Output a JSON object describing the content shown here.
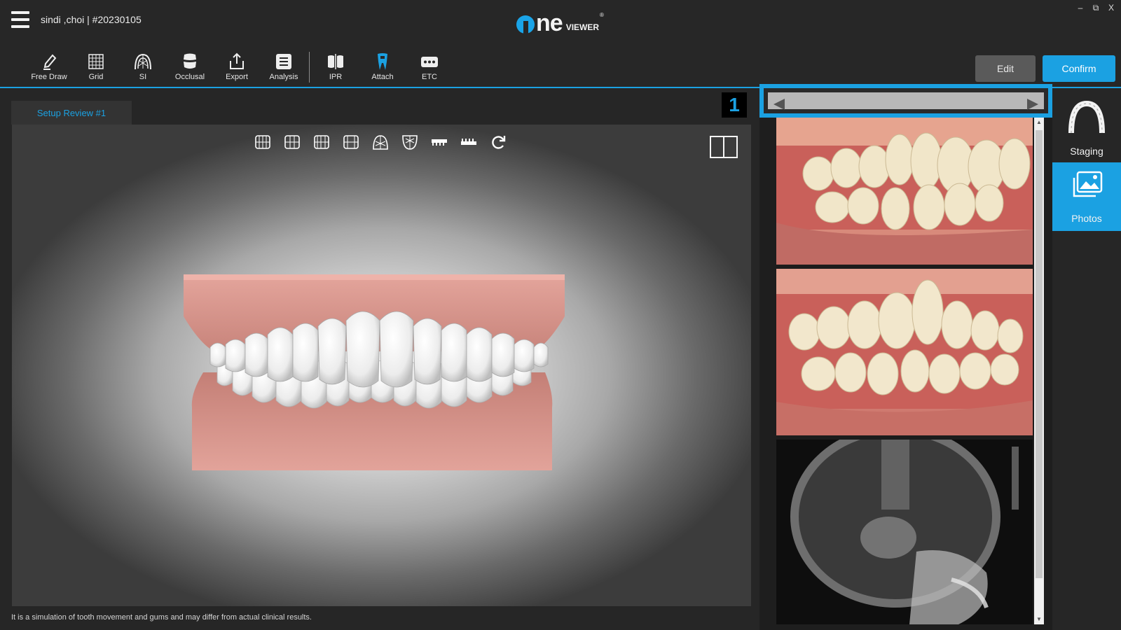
{
  "window": {
    "patient_info": "sindi ,choi | #20230105",
    "logo": {
      "word": "ne",
      "sub": "VIEWER",
      "reg": "®"
    },
    "controls": {
      "minimize": "–",
      "restore": "⧉",
      "close": "X"
    }
  },
  "toolbar": {
    "tools": [
      {
        "label": "Free Draw",
        "icon": "pencil-icon"
      },
      {
        "label": "Grid",
        "icon": "grid-icon"
      },
      {
        "label": "SI",
        "icon": "si-arch-icon"
      },
      {
        "label": "Occlusal",
        "icon": "tooth-icon"
      },
      {
        "label": "Export",
        "icon": "export-icon"
      },
      {
        "label": "Analysis",
        "icon": "list-icon"
      },
      {
        "label": "IPR",
        "icon": "ipr-icon"
      },
      {
        "label": "Attach",
        "icon": "attach-tooth-icon"
      },
      {
        "label": "ETC",
        "icon": "more-icon"
      }
    ],
    "edit_label": "Edit",
    "confirm_label": "Confirm"
  },
  "viewer": {
    "tab_label": "Setup Review #1",
    "stage_badge": "1",
    "view_tools": [
      "front-view-icon",
      "right-view-icon",
      "left-view-icon",
      "back-view-icon",
      "upper-arch-icon",
      "lower-arch-icon",
      "upper-jaw-icon",
      "lower-jaw-icon",
      "rotate-icon"
    ],
    "disclaimer": "It is a simulation of tooth movement and gums and may differ from actual clinical results."
  },
  "photos": {
    "items": [
      "intraoral-right-photo",
      "intraoral-left-photo",
      "cephalometric-xray"
    ]
  },
  "sidebar": {
    "items": [
      {
        "label": "Staging",
        "active": false
      },
      {
        "label": "Photos",
        "active": true
      }
    ]
  },
  "colors": {
    "accent": "#1ba1e2",
    "background": "#262626",
    "gum": "#d8958c",
    "tooth": "#f4f4f4"
  }
}
